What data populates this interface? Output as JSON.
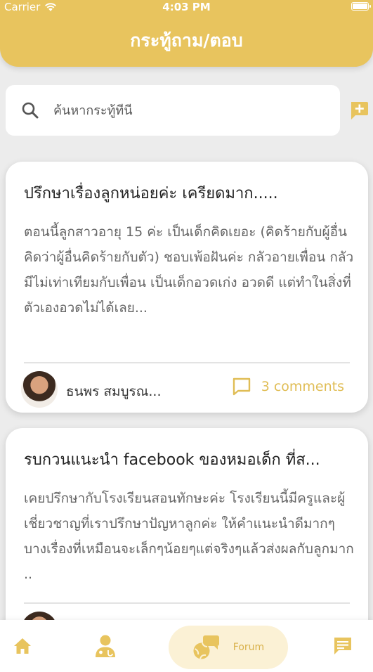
{
  "status_bar": {
    "carrier": "Carrier",
    "time": "4:03 PM"
  },
  "header": {
    "title": "กระทู้ถาม/ตอบ"
  },
  "search": {
    "placeholder": "ค้นหากระทู้ที่นี่"
  },
  "posts": [
    {
      "title": "ปรึกษาเรื่องลูกหน่อยค่ะ เครียดมาก.....",
      "body": "ตอนนี้ลูกสาวอายุ 15 ค่ะ เป็นเด็กคิดเยอะ (คิดร้ายกับผู้อื่น คิดว่าผู้อื่นคิดร้ายกับตัว) ชอบเพ้อฝันค่ะ กลัวอายเพื่อน กลัวมีไม่เท่าเทียมกับเพื่อน เป็นเด็กอวดเก่ง อวดดี แต่ทำในสิ่งที่ตัวเองอวดไม่ได้เลย...",
      "author": "ธนพร สมบูรณ...",
      "comments": "3 comments"
    },
    {
      "title": "รบกวนแนะนำ facebook ของหมอเด็ก ที่ส...",
      "body": "เคยปรึกษากับโรงเรียนสอนทักษะค่ะ โรงเรียนนี้มีครูและผู้เชี่ยวชาญที่เราปรึกษาปัญหาลูกค่ะ ให้คำแนะนำดีมากๆ บางเรื่องที่เหมือนจะเล็กๆน้อยๆแต่จริงๆแล้วส่งผลกับลูกมาก .."
    }
  ],
  "tabbar": {
    "forum_label": "Forum"
  },
  "colors": {
    "accent": "#e8c45e",
    "accent_text": "#e0bd55",
    "tab_active_bg": "#fbf1d5"
  }
}
